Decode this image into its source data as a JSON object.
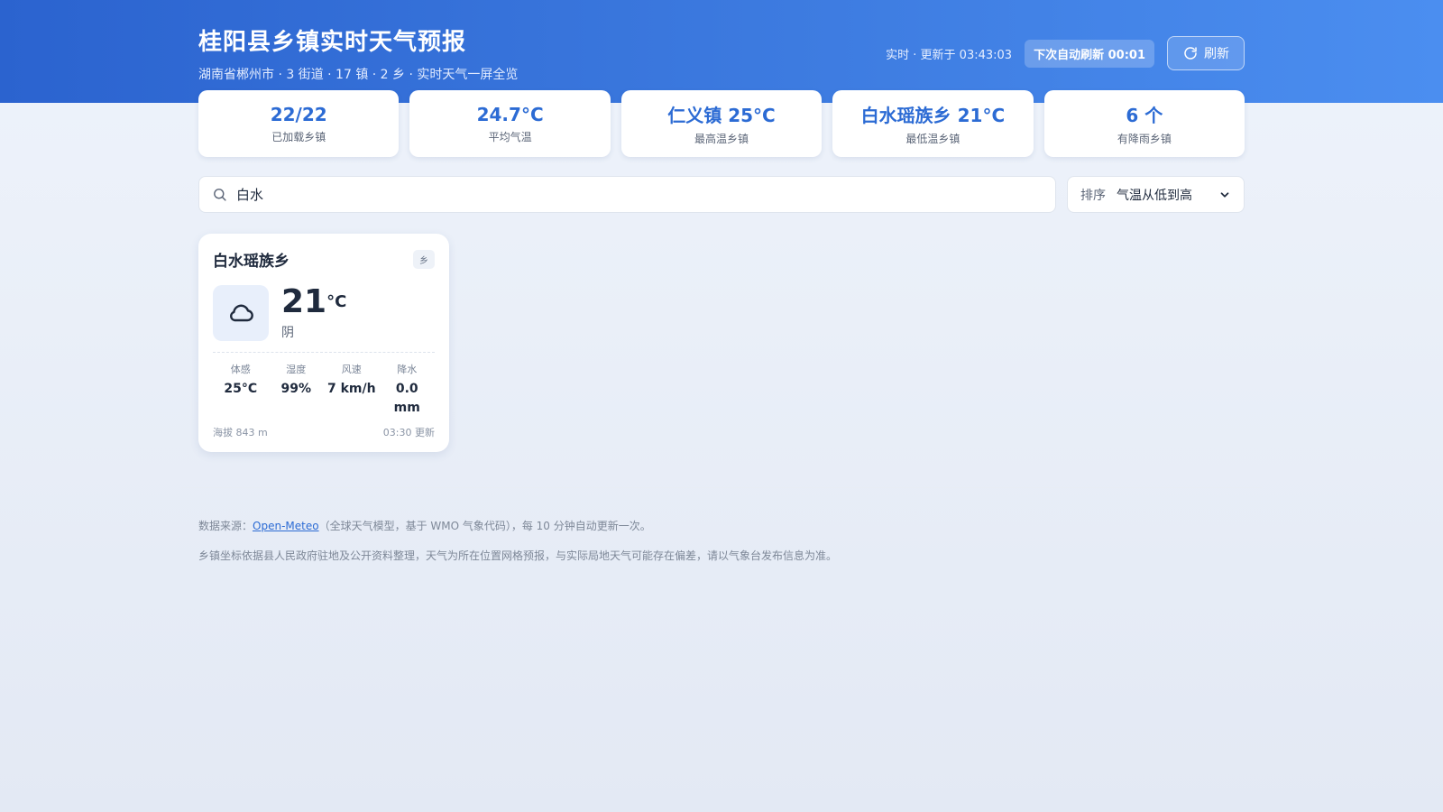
{
  "header": {
    "title": "桂阳县乡镇实时天气预报",
    "subtitle": "湖南省郴州市 · 3 街道 · 17 镇 · 2 乡 · 实时天气一屏全览",
    "updated": "实时 · 更新于 03:43:03",
    "countdown": "下次自动刷新 00:01",
    "refresh_label": "刷新"
  },
  "stats": [
    {
      "value": "22/22",
      "label": "已加载乡镇"
    },
    {
      "value": "24.7°C",
      "label": "平均气温"
    },
    {
      "value": "仁义镇 25°C",
      "label": "最高温乡镇"
    },
    {
      "value": "白水瑶族乡 21°C",
      "label": "最低温乡镇"
    },
    {
      "value": "6 个",
      "label": "有降雨乡镇"
    }
  ],
  "search": {
    "value": "白水"
  },
  "sort": {
    "label": "排序",
    "value": "气温从低到高"
  },
  "cards": [
    {
      "name": "白水瑶族乡",
      "tag": "乡",
      "icon": "cloud-icon",
      "temp": "21",
      "unit": "°C",
      "condition": "阴",
      "metrics": [
        {
          "label": "体感",
          "value": "25°C"
        },
        {
          "label": "湿度",
          "value": "99%"
        },
        {
          "label": "风速",
          "value": "7 km/h"
        },
        {
          "label": "降水",
          "value": "0.0 mm"
        }
      ],
      "elevation": "海拔 843 m",
      "updated": "03:30 更新"
    }
  ],
  "footer": {
    "source_prefix": "数据来源：",
    "source_link": "Open-Meteo",
    "source_suffix": "（全球天气模型，基于 WMO 气象代码），每 10 分钟自动更新一次。",
    "note": "乡镇坐标依据县人民政府驻地及公开资料整理，天气为所在位置网格预报，与实际局地天气可能存在偏差，请以气象台发布信息为准。"
  }
}
